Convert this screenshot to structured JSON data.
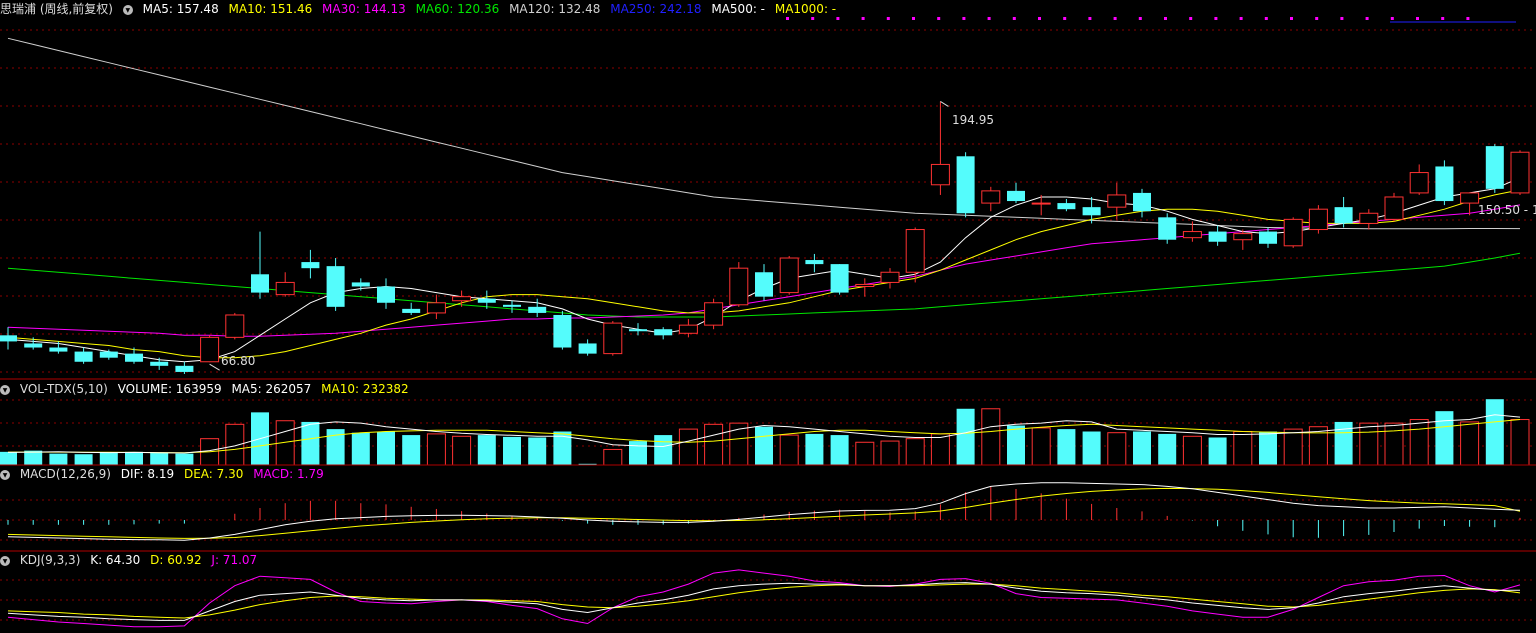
{
  "main_header": {
    "stock": "思瑞浦 (周线,前复权)",
    "ma5": "MA5: 157.48",
    "ma10": "MA10: 151.46",
    "ma30": "MA30: 144.13",
    "ma60": "MA60: 120.36",
    "ma120": "MA120: 132.48",
    "ma250": "MA250: 242.18",
    "ma500": "MA500: -",
    "ma1000": "MA1000: -"
  },
  "vol_header": {
    "name": "VOL-TDX(5,10)",
    "volume": "VOLUME: 163959",
    "ma5": "MA5: 262057",
    "ma10": "MA10: 232382"
  },
  "macd_header": {
    "name": "MACD(12,26,9)",
    "dif": "DIF: 8.19",
    "dea": "DEA: 7.30",
    "macd": "MACD: 1.79"
  },
  "kdj_header": {
    "name": "KDJ(9,3,3)",
    "k": "K: 64.30",
    "d": "D: 60.92",
    "j": "J: 71.07"
  },
  "annotations": {
    "high": "194.95",
    "low": "66.80",
    "last": "150.50 - 1"
  },
  "colors": {
    "up": "#ff3232",
    "down": "#54fcfc",
    "ma5": "#ffffff",
    "ma10": "#ffff00",
    "ma30": "#ff00ff",
    "ma60": "#00e600",
    "ma120": "#d0d0d0",
    "ma250": "#2020ff",
    "grid": "#8b0000",
    "divider": "#b00000"
  },
  "chart_data": {
    "type": "candlestick",
    "title": "思瑞浦 (周线,前复权)",
    "price_range": [
      60,
      235
    ],
    "candles": [
      {
        "o": 80,
        "h": 84,
        "l": 73,
        "c": 77
      },
      {
        "o": 76,
        "h": 79,
        "l": 73,
        "c": 74
      },
      {
        "o": 74,
        "h": 77,
        "l": 71,
        "c": 72
      },
      {
        "o": 72,
        "h": 74,
        "l": 66,
        "c": 67
      },
      {
        "o": 72,
        "h": 73,
        "l": 68,
        "c": 69
      },
      {
        "o": 71,
        "h": 74,
        "l": 66,
        "c": 67
      },
      {
        "o": 67,
        "h": 69,
        "l": 63,
        "c": 65
      },
      {
        "o": 65,
        "h": 67,
        "l": 61,
        "c": 62
      },
      {
        "o": 67,
        "h": 80,
        "l": 66.8,
        "c": 79
      },
      {
        "o": 79,
        "h": 91,
        "l": 78,
        "c": 90
      },
      {
        "o": 110,
        "h": 131,
        "l": 98,
        "c": 101
      },
      {
        "o": 100,
        "h": 111,
        "l": 99,
        "c": 106
      },
      {
        "o": 116,
        "h": 122,
        "l": 108,
        "c": 113
      },
      {
        "o": 114,
        "h": 118,
        "l": 92,
        "c": 94
      },
      {
        "o": 106,
        "h": 108,
        "l": 102,
        "c": 104
      },
      {
        "o": 104,
        "h": 108,
        "l": 93,
        "c": 96
      },
      {
        "o": 93,
        "h": 96,
        "l": 90,
        "c": 91
      },
      {
        "o": 91,
        "h": 100,
        "l": 88,
        "c": 96
      },
      {
        "o": 97,
        "h": 102,
        "l": 94,
        "c": 99
      },
      {
        "o": 98,
        "h": 102,
        "l": 93,
        "c": 96
      },
      {
        "o": 95,
        "h": 97,
        "l": 91,
        "c": 94
      },
      {
        "o": 94,
        "h": 98,
        "l": 89,
        "c": 91
      },
      {
        "o": 90,
        "h": 92,
        "l": 73,
        "c": 74
      },
      {
        "o": 76,
        "h": 78,
        "l": 70,
        "c": 71
      },
      {
        "o": 71,
        "h": 87,
        "l": 70,
        "c": 86
      },
      {
        "o": 83,
        "h": 86,
        "l": 80,
        "c": 82
      },
      {
        "o": 83,
        "h": 84,
        "l": 78,
        "c": 80
      },
      {
        "o": 81,
        "h": 88,
        "l": 79,
        "c": 85
      },
      {
        "o": 85,
        "h": 98,
        "l": 83,
        "c": 96
      },
      {
        "o": 95,
        "h": 116,
        "l": 94,
        "c": 113
      },
      {
        "o": 111,
        "h": 115,
        "l": 97,
        "c": 99
      },
      {
        "o": 101,
        "h": 119,
        "l": 100,
        "c": 118
      },
      {
        "o": 117,
        "h": 120,
        "l": 111,
        "c": 115
      },
      {
        "o": 115,
        "h": 115,
        "l": 100,
        "c": 101
      },
      {
        "o": 104,
        "h": 108,
        "l": 99,
        "c": 105
      },
      {
        "o": 106,
        "h": 113,
        "l": 103,
        "c": 111
      },
      {
        "o": 111,
        "h": 133,
        "l": 106,
        "c": 132
      },
      {
        "o": 154,
        "h": 194.95,
        "l": 149,
        "c": 164
      },
      {
        "o": 168,
        "h": 170,
        "l": 138,
        "c": 140
      },
      {
        "o": 145,
        "h": 153,
        "l": 141,
        "c": 151
      },
      {
        "o": 151,
        "h": 155,
        "l": 145,
        "c": 146
      },
      {
        "o": 145,
        "h": 149,
        "l": 139,
        "c": 145
      },
      {
        "o": 145,
        "h": 147,
        "l": 141,
        "c": 142
      },
      {
        "o": 143,
        "h": 148,
        "l": 135,
        "c": 139
      },
      {
        "o": 143,
        "h": 155,
        "l": 137,
        "c": 149
      },
      {
        "o": 150,
        "h": 152,
        "l": 138,
        "c": 141
      },
      {
        "o": 138,
        "h": 140,
        "l": 125,
        "c": 127
      },
      {
        "o": 128,
        "h": 136,
        "l": 126,
        "c": 131
      },
      {
        "o": 131,
        "h": 134,
        "l": 124,
        "c": 126
      },
      {
        "o": 127,
        "h": 132,
        "l": 122,
        "c": 130
      },
      {
        "o": 131,
        "h": 133,
        "l": 123,
        "c": 125
      },
      {
        "o": 124,
        "h": 138,
        "l": 123,
        "c": 137
      },
      {
        "o": 132,
        "h": 144,
        "l": 130,
        "c": 142
      },
      {
        "o": 143,
        "h": 148,
        "l": 133,
        "c": 135
      },
      {
        "o": 135,
        "h": 142,
        "l": 132,
        "c": 140
      },
      {
        "o": 137,
        "h": 150,
        "l": 136,
        "c": 148
      },
      {
        "o": 150,
        "h": 164,
        "l": 149,
        "c": 160
      },
      {
        "o": 163,
        "h": 166,
        "l": 144,
        "c": 146
      },
      {
        "o": 145,
        "h": 150,
        "l": 139,
        "c": 150
      },
      {
        "o": 173,
        "h": 174,
        "l": 150,
        "c": 152
      },
      {
        "o": 150,
        "h": 171,
        "l": 149,
        "c": 170
      }
    ],
    "ma": {
      "ma5": [
        78,
        77,
        76,
        74,
        72,
        70,
        68,
        67,
        68,
        72,
        80,
        88,
        96,
        101,
        103,
        104,
        103,
        101,
        99,
        98,
        97,
        96,
        93,
        88,
        85,
        83,
        81,
        83,
        89,
        97,
        103,
        108,
        110,
        112,
        110,
        108,
        110,
        116,
        128,
        138,
        144,
        148,
        148,
        147,
        145,
        144,
        141,
        137,
        134,
        131,
        130,
        131,
        133,
        135,
        137,
        140,
        144,
        148,
        150,
        152,
        157.48
      ],
      "ma10": [
        79,
        78,
        77,
        76,
        75,
        73,
        72,
        70,
        69,
        69,
        70,
        72,
        75,
        78,
        81,
        85,
        88,
        92,
        96,
        99,
        100,
        100,
        99,
        98,
        96,
        94,
        92,
        91,
        91,
        92,
        94,
        96,
        99,
        102,
        104,
        106,
        108,
        112,
        117,
        122,
        127,
        131,
        134,
        137,
        139,
        141,
        142,
        142,
        141,
        139,
        137,
        136,
        135,
        135,
        135,
        136,
        139,
        142,
        146,
        149,
        151.46
      ],
      "ma30": [
        84,
        83.5,
        83,
        82.5,
        82,
        81.5,
        81,
        80,
        80,
        79.5,
        79.5,
        80,
        80.5,
        81,
        82,
        83,
        84,
        85,
        86,
        87,
        88,
        88,
        88.5,
        88.5,
        89,
        89.5,
        90,
        91,
        93,
        95,
        97,
        99,
        101,
        103,
        105,
        107,
        109,
        112,
        115,
        117,
        119,
        121,
        123,
        125,
        126,
        127,
        128,
        129,
        130,
        131,
        132,
        133,
        134,
        135,
        136,
        137,
        138,
        139,
        140,
        142,
        144.13
      ],
      "ma60": [
        113,
        112,
        111,
        110,
        109,
        108,
        107,
        106,
        105,
        104,
        103,
        102,
        101,
        100,
        99,
        98,
        97,
        96,
        95,
        94,
        93,
        92,
        91,
        90,
        89.5,
        89,
        89,
        89,
        89,
        89.5,
        90,
        90.5,
        91,
        91.5,
        92,
        92.5,
        93,
        94,
        95,
        96,
        97,
        98,
        99,
        100,
        101,
        102,
        103,
        104,
        105,
        106,
        107,
        108,
        109,
        110,
        111,
        112,
        113,
        114,
        116,
        118,
        120.36
      ],
      "ma120": [
        226,
        223,
        220,
        217,
        214,
        211,
        208,
        205,
        202,
        199,
        196,
        193,
        190,
        187,
        184,
        181,
        178,
        175,
        172,
        169,
        166,
        163,
        160,
        158,
        156,
        154,
        152,
        150,
        148,
        147,
        146,
        145,
        144,
        143,
        142,
        141,
        140,
        139.5,
        139,
        138.5,
        138,
        137.5,
        137,
        136.5,
        136,
        135.5,
        135,
        134.5,
        134,
        133.5,
        133,
        132.8,
        132.6,
        132.5,
        132.4,
        132.4,
        132.4,
        132.4,
        132.5,
        132.5,
        132.48
      ]
    },
    "volume": {
      "values": [
        110,
        120,
        95,
        90,
        105,
        110,
        100,
        95,
        220,
        340,
        440,
        370,
        360,
        300,
        270,
        280,
        250,
        260,
        240,
        250,
        235,
        230,
        280,
        10,
        130,
        200,
        250,
        300,
        340,
        350,
        320,
        250,
        260,
        250,
        190,
        200,
        220,
        260,
        470,
        470,
        330,
        310,
        300,
        280,
        270,
        280,
        260,
        240,
        230,
        280,
        280,
        300,
        320,
        360,
        350,
        350,
        380,
        450,
        360,
        550,
        380
      ],
      "ma5": [
        105,
        108,
        110,
        105,
        104,
        105,
        102,
        100,
        120,
        160,
        220,
        280,
        340,
        360,
        350,
        320,
        300,
        280,
        265,
        255,
        248,
        240,
        240,
        210,
        170,
        160,
        155,
        200,
        250,
        300,
        330,
        320,
        300,
        280,
        260,
        240,
        230,
        230,
        270,
        320,
        340,
        350,
        370,
        360,
        300,
        290,
        280,
        270,
        255,
        255,
        260,
        270,
        280,
        300,
        320,
        330,
        350,
        370,
        380,
        420,
        400
      ],
      "ma10": [
        108,
        108,
        108,
        107,
        106,
        105,
        104,
        103,
        110,
        130,
        160,
        190,
        220,
        250,
        270,
        280,
        285,
        290,
        290,
        290,
        280,
        270,
        260,
        240,
        220,
        205,
        195,
        190,
        200,
        220,
        240,
        260,
        280,
        290,
        290,
        280,
        270,
        260,
        265,
        280,
        300,
        315,
        330,
        340,
        330,
        320,
        310,
        300,
        290,
        280,
        275,
        270,
        268,
        270,
        275,
        285,
        300,
        320,
        340,
        360,
        380
      ]
    },
    "macd": {
      "dif": [
        -14,
        -14.5,
        -15,
        -15.5,
        -16,
        -16.3,
        -16.5,
        -16.8,
        -15,
        -12,
        -8,
        -4,
        -1,
        1,
        2,
        3,
        3.5,
        3.8,
        3.9,
        3.7,
        3.3,
        2.5,
        1.5,
        0,
        -1,
        -1.6,
        -2,
        -2,
        -1,
        0.5,
        2.5,
        4.5,
        6,
        7.5,
        8,
        8.2,
        9.5,
        14,
        22,
        28,
        30,
        31,
        31,
        30.5,
        30,
        29.5,
        28,
        26,
        23,
        20,
        17,
        14,
        12,
        11,
        10,
        10,
        10.5,
        11,
        10,
        9,
        8.19
      ],
      "dea": [
        -12,
        -12.5,
        -13,
        -13.5,
        -14,
        -14.5,
        -15,
        -15.3,
        -15.2,
        -14.6,
        -13,
        -11,
        -9,
        -7,
        -5,
        -3.5,
        -2,
        -0.8,
        0.2,
        1,
        1.5,
        1.8,
        1.8,
        1.5,
        1,
        0.4,
        -0.1,
        -0.5,
        -0.6,
        -0.4,
        0.2,
        1.1,
        2.1,
        3.2,
        4.2,
        5,
        5.9,
        7.5,
        10.4,
        13.9,
        17.1,
        19.9,
        22.1,
        23.8,
        25,
        25.9,
        26.3,
        26.2,
        25.6,
        24.5,
        23,
        21.2,
        19.4,
        17.7,
        16.2,
        15,
        14.1,
        13.5,
        12.8,
        12,
        7.3
      ]
    },
    "kdj": {
      "k": [
        35,
        33,
        31,
        30,
        28,
        27,
        26,
        26,
        38,
        50,
        58,
        60,
        62,
        58,
        54,
        52,
        51,
        52,
        52,
        51,
        49,
        47,
        40,
        36,
        42,
        48,
        52,
        58,
        66,
        70,
        72,
        73,
        72,
        72,
        70,
        70,
        71,
        73,
        74,
        72,
        67,
        63,
        61,
        60,
        58,
        55,
        52,
        48,
        45,
        42,
        40,
        42,
        48,
        56,
        60,
        63,
        67,
        70,
        67,
        64,
        64.3
      ],
      "d": [
        38,
        37,
        36,
        34,
        33,
        31,
        30,
        29,
        33,
        39,
        46,
        51,
        55,
        57,
        56,
        54,
        53,
        52,
        52,
        52,
        51,
        50,
        46,
        43,
        42,
        44,
        47,
        51,
        56,
        61,
        65,
        68,
        70,
        71,
        70,
        70,
        70,
        71,
        72,
        72,
        70,
        67,
        65,
        63,
        61,
        58,
        56,
        53,
        50,
        47,
        44,
        43,
        45,
        49,
        53,
        57,
        61,
        64,
        66,
        65,
        60.92
      ],
      "j": [
        30,
        27,
        24,
        22,
        20,
        18,
        18,
        19,
        48,
        70,
        82,
        80,
        78,
        62,
        50,
        48,
        47,
        50,
        52,
        50,
        45,
        41,
        28,
        22,
        42,
        56,
        62,
        72,
        86,
        90,
        86,
        82,
        76,
        74,
        70,
        69,
        72,
        78,
        79,
        73,
        60,
        55,
        54,
        53,
        52,
        48,
        44,
        38,
        34,
        30,
        30,
        40,
        55,
        70,
        75,
        77,
        82,
        83,
        70,
        62,
        71.07
      ]
    }
  }
}
